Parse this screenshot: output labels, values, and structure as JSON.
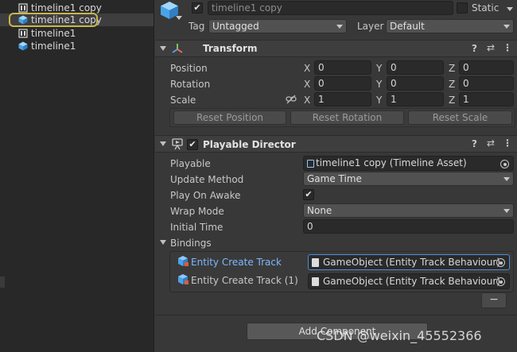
{
  "hierarchy": {
    "items": [
      {
        "label": "timeline1 copy",
        "icon": "timeline-icon",
        "selected": false
      },
      {
        "label": "timeline1 copy",
        "icon": "cube-icon",
        "selected": true
      },
      {
        "label": "timeline1",
        "icon": "timeline-icon",
        "selected": false
      },
      {
        "label": "timeline1",
        "icon": "cube-icon",
        "selected": false
      }
    ]
  },
  "object_header": {
    "name": "timeline1 copy",
    "static_label": "Static",
    "tag_label": "Tag",
    "tag_value": "Untagged",
    "layer_label": "Layer",
    "layer_value": "Default"
  },
  "transform": {
    "title": "Transform",
    "rows": [
      {
        "label": "Position",
        "x": "0",
        "y": "0",
        "z": "0"
      },
      {
        "label": "Rotation",
        "x": "0",
        "y": "0",
        "z": "0"
      },
      {
        "label": "Scale",
        "x": "1",
        "y": "1",
        "z": "1"
      }
    ],
    "axes": {
      "x": "X",
      "y": "Y",
      "z": "Z"
    },
    "buttons": {
      "reset_position": "Reset Position",
      "reset_rotation": "Reset Rotation",
      "reset_scale": "Reset Scale"
    }
  },
  "playable_director": {
    "title": "Playable Director",
    "playable_label": "Playable",
    "playable_value": "timeline1 copy (Timeline Asset)",
    "update_method_label": "Update Method",
    "update_method_value": "Game Time",
    "play_on_awake_label": "Play On Awake",
    "play_on_awake": "✔",
    "wrap_mode_label": "Wrap Mode",
    "wrap_mode_value": "None",
    "initial_time_label": "Initial Time",
    "initial_time_value": "0",
    "bindings_label": "Bindings",
    "bindings": [
      {
        "track": "Entity Create Track",
        "object": "GameObject (Entity Track Behaviour)"
      },
      {
        "track": "Entity Create Track (1)",
        "object": "GameObject (Entity Track Behaviour)"
      }
    ],
    "remove_label": "−"
  },
  "add_component": "Add Component",
  "watermark": "CSDN @weixin_45552366",
  "colors": {
    "selection_ring": "#c9b74a",
    "binding_highlight": "#7cb8ff"
  }
}
